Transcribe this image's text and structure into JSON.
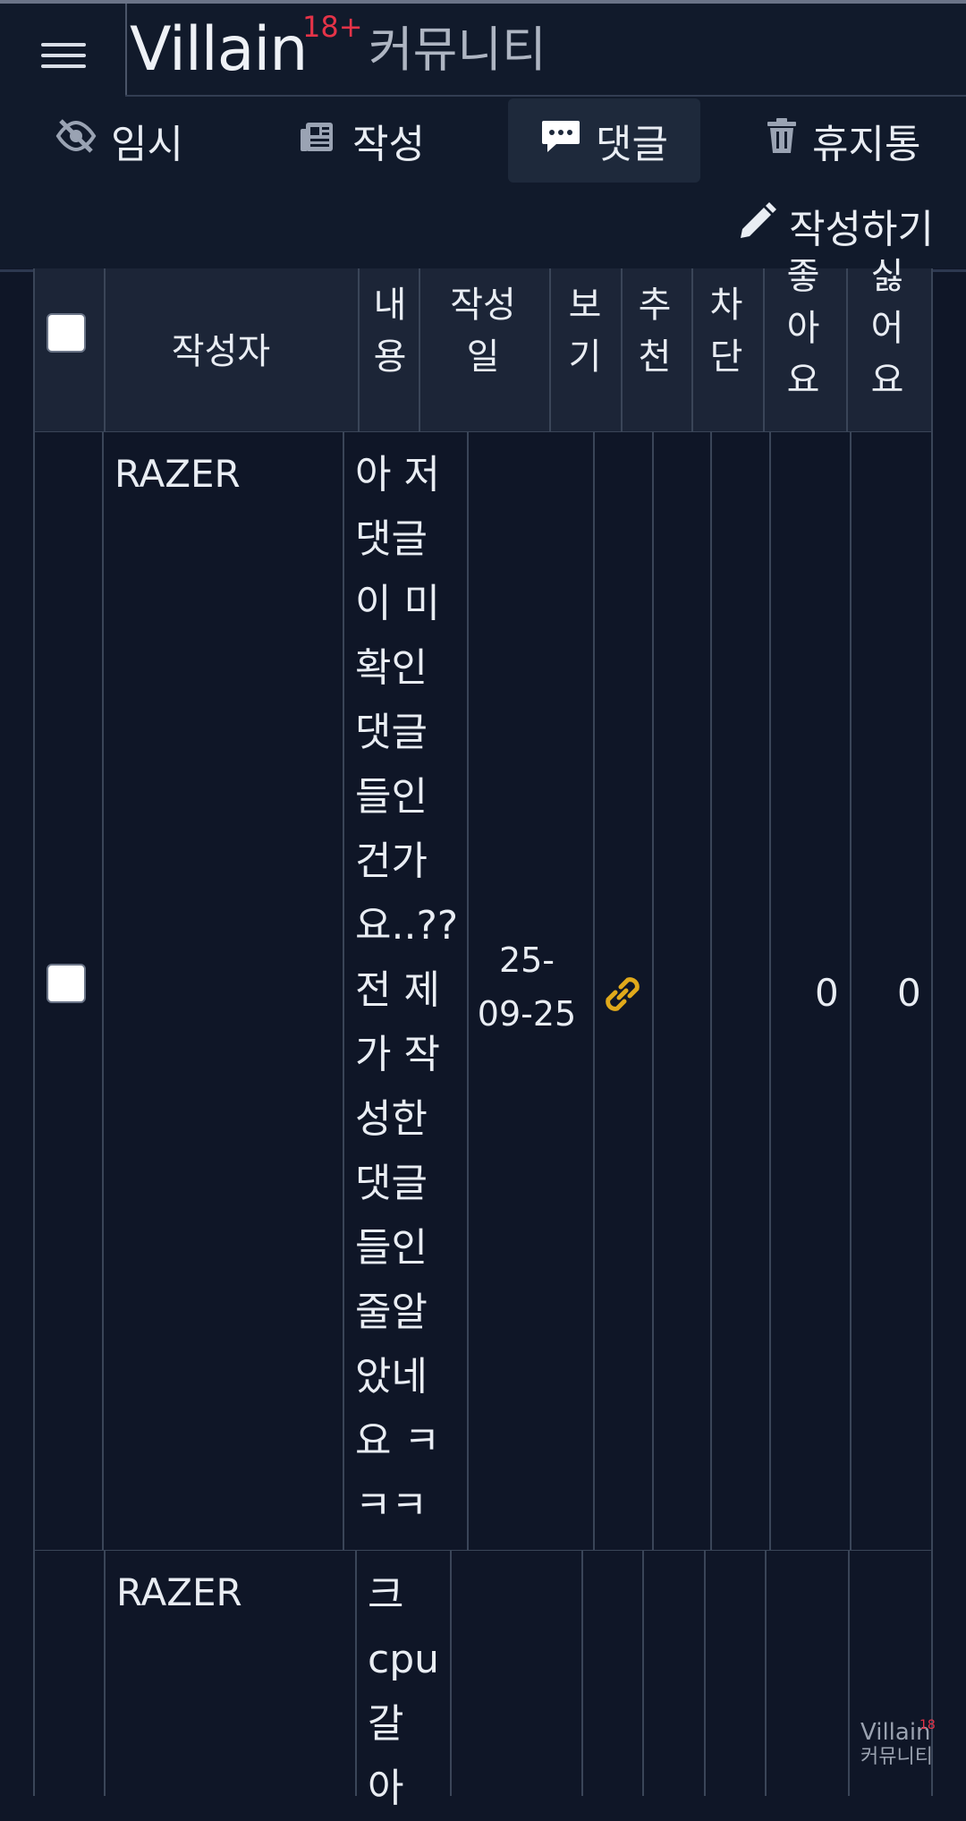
{
  "header": {
    "brand": "Villain",
    "brand_sup": "18+",
    "brand_sub": "커뮤니티",
    "menu_icon": "hamburger-menu-icon"
  },
  "tabs": [
    {
      "label": "임시",
      "icon": "eye-off-icon",
      "active": false
    },
    {
      "label": "작성",
      "icon": "newspaper-icon",
      "active": false
    },
    {
      "label": "댓글",
      "icon": "comment-icon",
      "active": true
    },
    {
      "label": "휴지통",
      "icon": "trash-icon",
      "active": false
    }
  ],
  "write_button": {
    "label": "작성하기",
    "icon": "pencil-icon"
  },
  "table": {
    "headers": [
      "작성자",
      "내용",
      "작성일",
      "보기",
      "추천",
      "차단",
      "좋아요",
      "싫어요"
    ],
    "header_display": [
      "작성자",
      "내\n용",
      "작성\n일",
      "보\n기",
      "추\n천",
      "차\n단",
      "좋\n아\n요",
      "싫\n어\n요"
    ],
    "rows": [
      {
        "author": "RAZER",
        "content": "아 저 댓글이 미확인 댓글들인건가요..?? 전 제가 작성한 댓글들인 줄알았네요 ㅋㅋㅋ",
        "content_lines": [
          "아 저",
          "댓글",
          "이 미",
          "확인",
          "댓글",
          "들인",
          "건가",
          "요..??",
          "전 제",
          "가 작",
          "성한",
          "댓글",
          "들인",
          "줄알",
          "았네",
          "요 ㅋ",
          "ㅋㅋ"
        ],
        "date": "25-09-25",
        "date_lines": [
          "25-",
          "09-25"
        ],
        "link_icon": "link-icon",
        "likes": "0",
        "dislikes": "0"
      },
      {
        "author": "RAZER",
        "content_lines": [
          "크",
          "cpu",
          "갈",
          "아"
        ]
      }
    ]
  },
  "watermark": {
    "brand": "Villain",
    "sup": "18",
    "sub": "커뮤니티"
  },
  "colors": {
    "background": "#0f1627",
    "header": "#111a2b",
    "table_head": "#1c2537",
    "accent_red": "#e53348",
    "link": "#e0a91b"
  }
}
